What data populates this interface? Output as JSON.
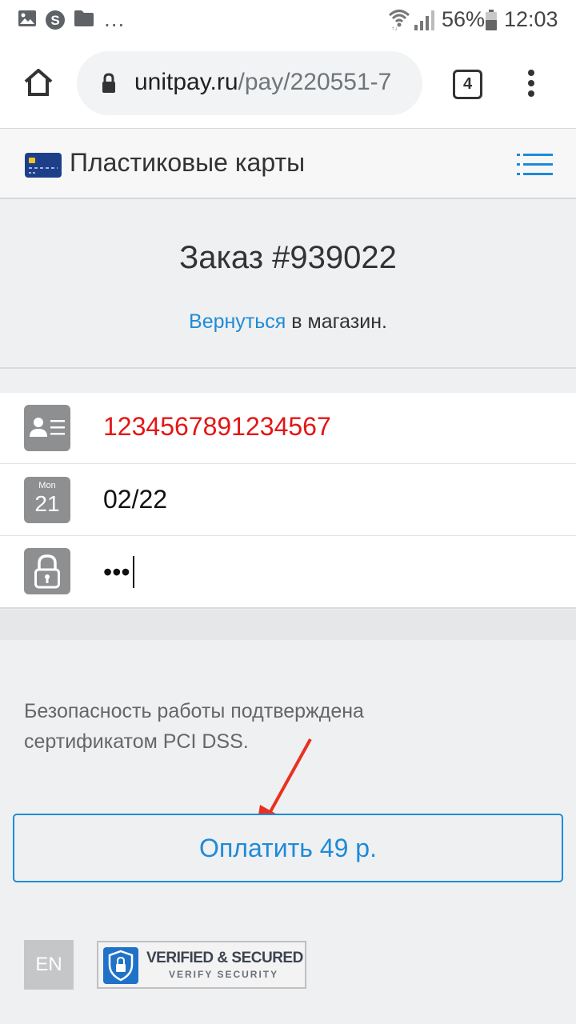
{
  "status_bar": {
    "battery_percent": "56%",
    "time": "12:03",
    "overflow": "..."
  },
  "browser": {
    "url_host": "unitpay.ru",
    "url_path": "/pay/220551-7",
    "tab_count": "4"
  },
  "header": {
    "title": "Пластиковые карты"
  },
  "order": {
    "title": "Заказ #939022",
    "back_link": "Вернуться",
    "back_suffix": " в магазин."
  },
  "form": {
    "card_number": "1234567891234567",
    "expiry": "02/22",
    "cvv_mask": "•••",
    "calendar_icon_month": "Mon",
    "calendar_icon_day": "21"
  },
  "security_note": "Безопасность работы подтверждена сертификатом PCI DSS.",
  "pay_button": "Оплатить 49 р.",
  "language_button": "EN",
  "badge": {
    "line1": "VERIFIED & SECURED",
    "line2": "VERIFY SECURITY"
  },
  "colors": {
    "accent": "#1e8bd8",
    "error": "#e31616",
    "arrow": "#e8321f"
  }
}
